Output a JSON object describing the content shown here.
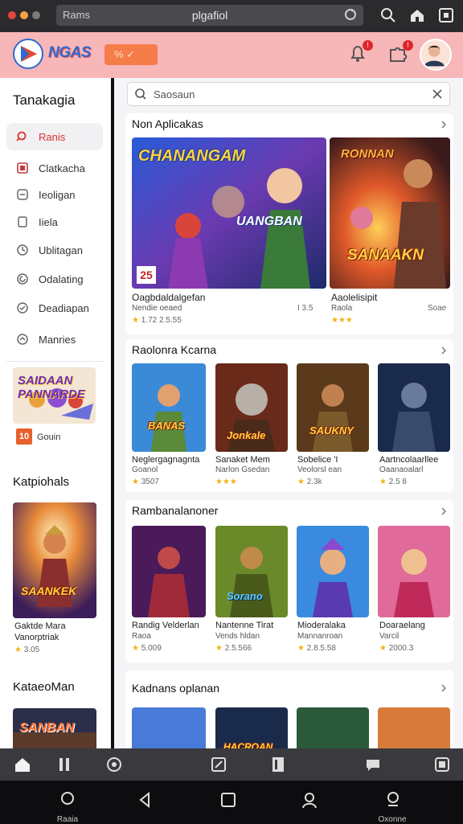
{
  "browser": {
    "url_left": "Rams",
    "url": "plgafiol"
  },
  "header": {
    "logo_text": "NGAS",
    "promo_text": "% ✓",
    "notification_count": "!",
    "messages_count": "!"
  },
  "search": {
    "placeholder": "Saosaun"
  },
  "sidebar": {
    "title": "Tanakagia",
    "items": [
      {
        "label": "Ranis",
        "icon": "search-icon",
        "active": true
      },
      {
        "label": "Clatkacha",
        "icon": "gift-icon"
      },
      {
        "label": "Ieoligan",
        "icon": "inbox-icon"
      },
      {
        "label": "Iiela",
        "icon": "page-icon"
      },
      {
        "label": "Ublitagan",
        "icon": "clock-icon"
      },
      {
        "label": "Odalating",
        "icon": "refresh-icon"
      },
      {
        "label": "Deadiapan",
        "icon": "check-icon"
      },
      {
        "label": "Manries",
        "icon": "settings-icon"
      }
    ],
    "promo_card": {
      "art_text": "SAIDAAN PANNARDE",
      "badge": "10",
      "caption": "Gouin"
    },
    "section2_title": "Katpiohals",
    "featured": {
      "art_text": "SAANKEK",
      "name": "Gaktde Mara",
      "sub": "Vanorptriak",
      "rating": "3.05"
    },
    "section3_title": "KataeoMan",
    "bottom_art_text": "SANBAN"
  },
  "sections": [
    {
      "title": "Non Aplicakas",
      "cards": [
        {
          "art_text": "CHANANGAM",
          "art_text2": "UANGBAN",
          "badge": "25",
          "name": "Oagbdaldalgefan",
          "sub": "Nendie oeaed",
          "price": "I 3.5",
          "rating": "1.72 2.5.55"
        },
        {
          "art_text": "RONNAN",
          "art_text2": "SANAAKN",
          "badge": "",
          "name": "Aaolelisipit",
          "sub": "Raola",
          "price": "Soae",
          "rating": "★★★"
        }
      ]
    },
    {
      "title": "Raolonra Kcarna",
      "cards": [
        {
          "art_text": "BANAS",
          "name": "Neglergagnagnta",
          "sub": "Goanol",
          "rating": "3507"
        },
        {
          "art_text": "Jonkale",
          "name": "Sanaket Mem",
          "sub": "Narlon Gsedan",
          "rating": "★★★"
        },
        {
          "art_text": "SAUKNY",
          "name": "Sobelice 'I",
          "sub": "Veolorsl ean",
          "rating": "2.3k"
        },
        {
          "art_text": "",
          "name": "Aartncolaarllee",
          "sub": "Oaanaoalarl",
          "rating": "2.5 8"
        }
      ]
    },
    {
      "title": "Rambanalanoner",
      "cards": [
        {
          "art_text": "",
          "name": "Randig Velderlan",
          "sub": "Raoa",
          "rating": "5.009"
        },
        {
          "art_text": "Sorano",
          "name": "Nantenne Tirat",
          "sub": "Vends hldan",
          "rating": "2.5.566"
        },
        {
          "art_text": "",
          "name": "Mioderalaka",
          "sub": "Mannanroan",
          "rating": "2.8.5.58"
        },
        {
          "art_text": "",
          "name": "Doaraelang",
          "sub": "Varcil",
          "rating": "2000.3"
        }
      ]
    },
    {
      "title": "Kadnans oplanan",
      "cards": [
        {
          "art_text": ""
        },
        {
          "art_text": "HACROAN"
        },
        {
          "art_text": ""
        },
        {
          "art_text": ""
        }
      ]
    }
  ],
  "navbar": {
    "home_label": "Raaia",
    "profile_label": "Oxonne"
  },
  "colors": {
    "header_bg": "#f7b6b8",
    "accent": "#d9322f",
    "star": "#f2b21a"
  }
}
